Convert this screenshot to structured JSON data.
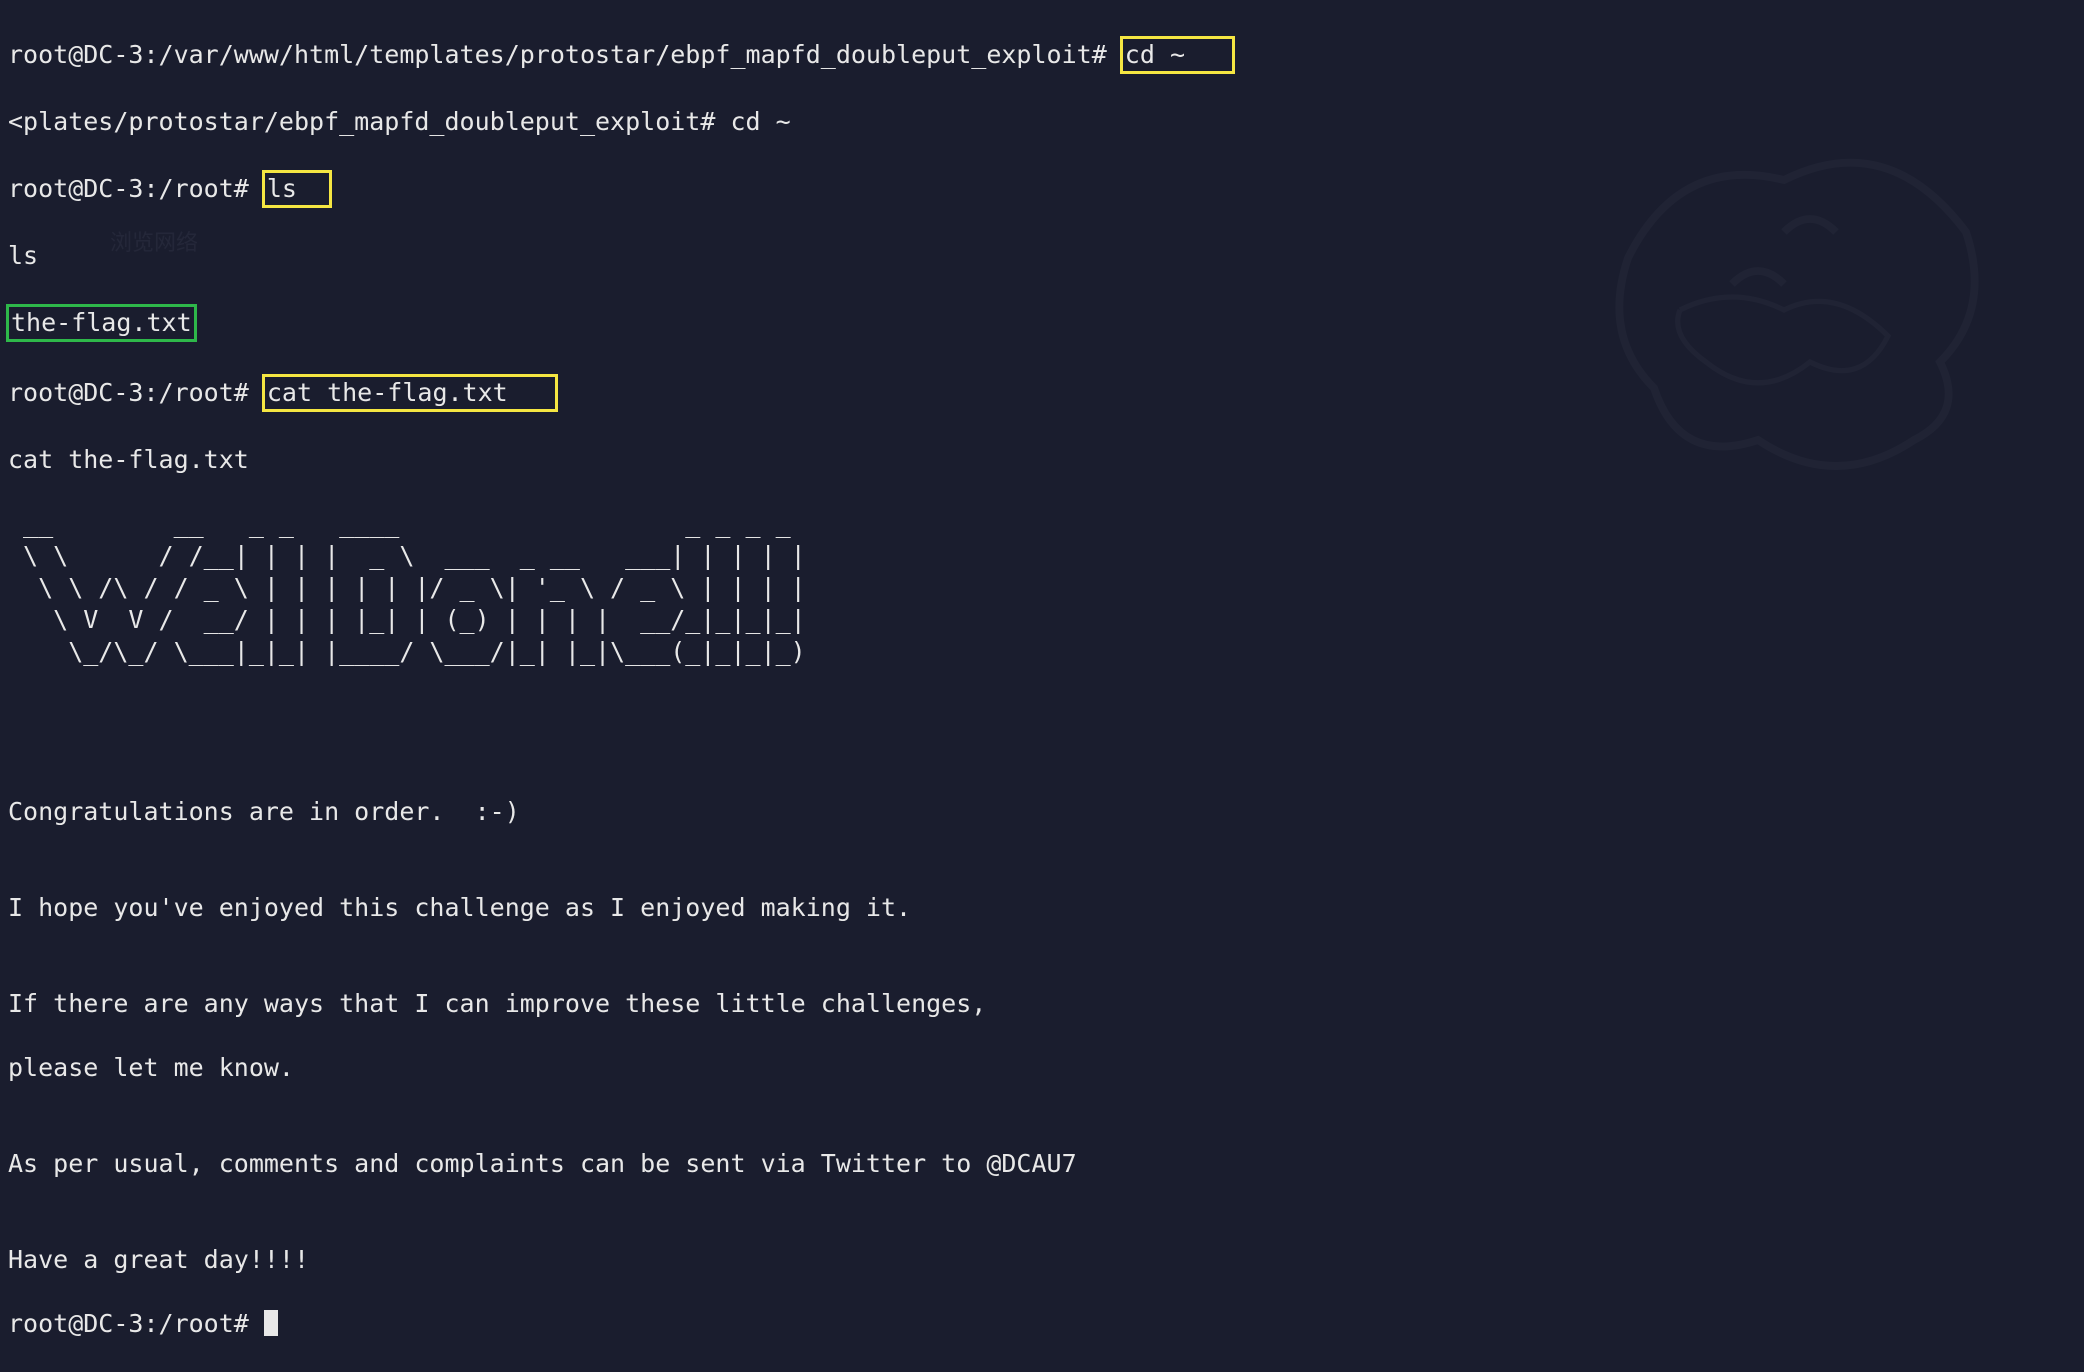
{
  "prompt1": "root@DC-3:/var/www/html/templates/protostar/ebpf_mapfd_doubleput_exploit# ",
  "cmd1": "cd ~",
  "echo1": "<plates/protostar/ebpf_mapfd_doubleput_exploit# cd ~",
  "prompt2": "root@DC-3:/root# ",
  "cmd2": "ls",
  "echo2": "ls",
  "file1": "the-flag.txt",
  "prompt3": "root@DC-3:/root# ",
  "cmd3": "cat the-flag.txt",
  "echo3": "cat the-flag.txt",
  "ascii_art": " __        __   _ _   ____                   _ _ _ _ \n \\ \\      / /__| | | |  _ \\  ___  _ __   ___| | | | |\n  \\ \\ /\\ / / _ \\ | | | | | |/ _ \\| '_ \\ / _ \\ | | | |\n   \\ V  V /  __/ | | | |_| | (_) | | | |  __/_|_|_|_|\n    \\_/\\_/ \\___|_|_| |____/ \\___/|_| |_|\\___(_|_|_|_)\n                                                     ",
  "msg_blank": "",
  "msg1": "Congratulations are in order.  :-)",
  "msg2": "I hope you've enjoyed this challenge as I enjoyed making it.",
  "msg3a": "If there are any ways that I can improve these little challenges,",
  "msg3b": "please let me know.",
  "msg4": "As per usual, comments and complaints can be sent via Twitter to @DCAU7",
  "msg5": "Have a great day!!!!",
  "prompt4": "root@DC-3:/root# ",
  "ghost_browse": "浏览网络",
  "ghost_text": ""
}
